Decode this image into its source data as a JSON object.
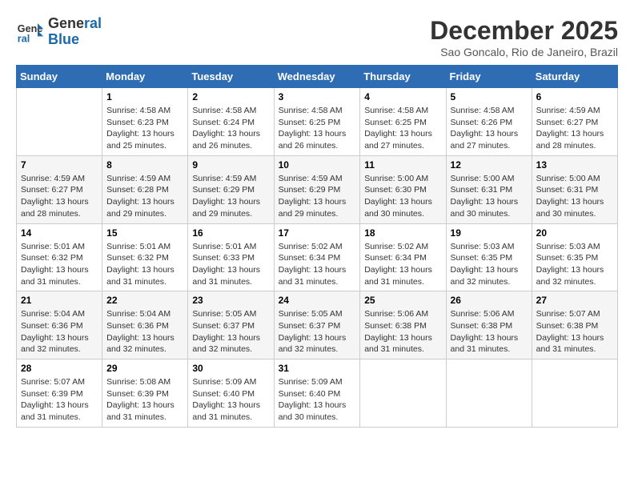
{
  "header": {
    "logo_line1": "General",
    "logo_line2": "Blue",
    "month_title": "December 2025",
    "location": "Sao Goncalo, Rio de Janeiro, Brazil"
  },
  "days_of_week": [
    "Sunday",
    "Monday",
    "Tuesday",
    "Wednesday",
    "Thursday",
    "Friday",
    "Saturday"
  ],
  "weeks": [
    [
      {
        "day": "",
        "content": ""
      },
      {
        "day": "1",
        "content": "Sunrise: 4:58 AM\nSunset: 6:23 PM\nDaylight: 13 hours\nand 25 minutes."
      },
      {
        "day": "2",
        "content": "Sunrise: 4:58 AM\nSunset: 6:24 PM\nDaylight: 13 hours\nand 26 minutes."
      },
      {
        "day": "3",
        "content": "Sunrise: 4:58 AM\nSunset: 6:25 PM\nDaylight: 13 hours\nand 26 minutes."
      },
      {
        "day": "4",
        "content": "Sunrise: 4:58 AM\nSunset: 6:25 PM\nDaylight: 13 hours\nand 27 minutes."
      },
      {
        "day": "5",
        "content": "Sunrise: 4:58 AM\nSunset: 6:26 PM\nDaylight: 13 hours\nand 27 minutes."
      },
      {
        "day": "6",
        "content": "Sunrise: 4:59 AM\nSunset: 6:27 PM\nDaylight: 13 hours\nand 28 minutes."
      }
    ],
    [
      {
        "day": "7",
        "content": "Sunrise: 4:59 AM\nSunset: 6:27 PM\nDaylight: 13 hours\nand 28 minutes."
      },
      {
        "day": "8",
        "content": "Sunrise: 4:59 AM\nSunset: 6:28 PM\nDaylight: 13 hours\nand 29 minutes."
      },
      {
        "day": "9",
        "content": "Sunrise: 4:59 AM\nSunset: 6:29 PM\nDaylight: 13 hours\nand 29 minutes."
      },
      {
        "day": "10",
        "content": "Sunrise: 4:59 AM\nSunset: 6:29 PM\nDaylight: 13 hours\nand 29 minutes."
      },
      {
        "day": "11",
        "content": "Sunrise: 5:00 AM\nSunset: 6:30 PM\nDaylight: 13 hours\nand 30 minutes."
      },
      {
        "day": "12",
        "content": "Sunrise: 5:00 AM\nSunset: 6:31 PM\nDaylight: 13 hours\nand 30 minutes."
      },
      {
        "day": "13",
        "content": "Sunrise: 5:00 AM\nSunset: 6:31 PM\nDaylight: 13 hours\nand 30 minutes."
      }
    ],
    [
      {
        "day": "14",
        "content": "Sunrise: 5:01 AM\nSunset: 6:32 PM\nDaylight: 13 hours\nand 31 minutes."
      },
      {
        "day": "15",
        "content": "Sunrise: 5:01 AM\nSunset: 6:32 PM\nDaylight: 13 hours\nand 31 minutes."
      },
      {
        "day": "16",
        "content": "Sunrise: 5:01 AM\nSunset: 6:33 PM\nDaylight: 13 hours\nand 31 minutes."
      },
      {
        "day": "17",
        "content": "Sunrise: 5:02 AM\nSunset: 6:34 PM\nDaylight: 13 hours\nand 31 minutes."
      },
      {
        "day": "18",
        "content": "Sunrise: 5:02 AM\nSunset: 6:34 PM\nDaylight: 13 hours\nand 31 minutes."
      },
      {
        "day": "19",
        "content": "Sunrise: 5:03 AM\nSunset: 6:35 PM\nDaylight: 13 hours\nand 32 minutes."
      },
      {
        "day": "20",
        "content": "Sunrise: 5:03 AM\nSunset: 6:35 PM\nDaylight: 13 hours\nand 32 minutes."
      }
    ],
    [
      {
        "day": "21",
        "content": "Sunrise: 5:04 AM\nSunset: 6:36 PM\nDaylight: 13 hours\nand 32 minutes."
      },
      {
        "day": "22",
        "content": "Sunrise: 5:04 AM\nSunset: 6:36 PM\nDaylight: 13 hours\nand 32 minutes."
      },
      {
        "day": "23",
        "content": "Sunrise: 5:05 AM\nSunset: 6:37 PM\nDaylight: 13 hours\nand 32 minutes."
      },
      {
        "day": "24",
        "content": "Sunrise: 5:05 AM\nSunset: 6:37 PM\nDaylight: 13 hours\nand 32 minutes."
      },
      {
        "day": "25",
        "content": "Sunrise: 5:06 AM\nSunset: 6:38 PM\nDaylight: 13 hours\nand 31 minutes."
      },
      {
        "day": "26",
        "content": "Sunrise: 5:06 AM\nSunset: 6:38 PM\nDaylight: 13 hours\nand 31 minutes."
      },
      {
        "day": "27",
        "content": "Sunrise: 5:07 AM\nSunset: 6:38 PM\nDaylight: 13 hours\nand 31 minutes."
      }
    ],
    [
      {
        "day": "28",
        "content": "Sunrise: 5:07 AM\nSunset: 6:39 PM\nDaylight: 13 hours\nand 31 minutes."
      },
      {
        "day": "29",
        "content": "Sunrise: 5:08 AM\nSunset: 6:39 PM\nDaylight: 13 hours\nand 31 minutes."
      },
      {
        "day": "30",
        "content": "Sunrise: 5:09 AM\nSunset: 6:40 PM\nDaylight: 13 hours\nand 31 minutes."
      },
      {
        "day": "31",
        "content": "Sunrise: 5:09 AM\nSunset: 6:40 PM\nDaylight: 13 hours\nand 30 minutes."
      },
      {
        "day": "",
        "content": ""
      },
      {
        "day": "",
        "content": ""
      },
      {
        "day": "",
        "content": ""
      }
    ]
  ]
}
